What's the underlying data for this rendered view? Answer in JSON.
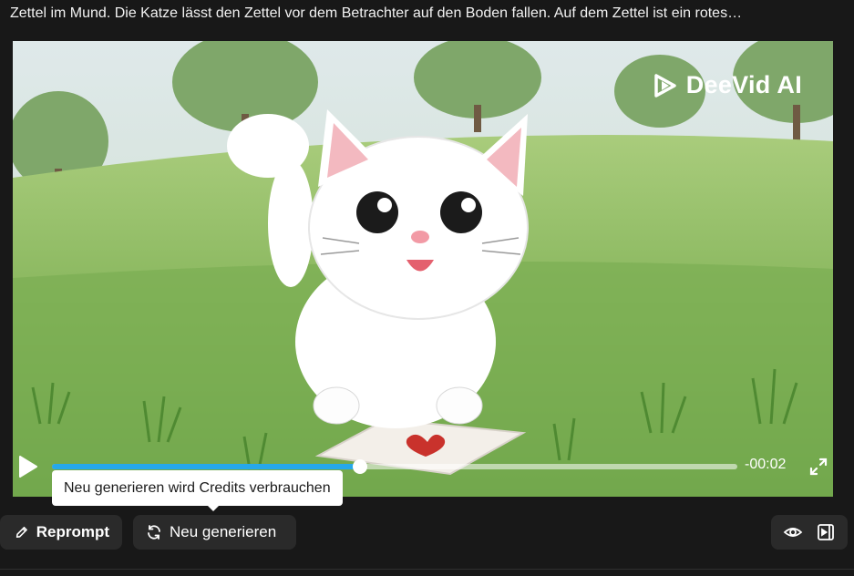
{
  "prompt": {
    "text": "Zettel im Mund. Die Katze lässt den Zettel vor dem Betrachter auf den Boden fallen. Auf dem Zettel ist ein rotes…"
  },
  "video": {
    "watermark": "DeeVid AI",
    "time_remaining": "-00:02",
    "progress": 0.45
  },
  "tooltip": {
    "text": "Neu generieren wird Credits verbrauchen"
  },
  "actions": {
    "reprompt_label": "Reprompt",
    "regenerate_label": "Neu generieren"
  },
  "icons": {
    "play": "play-icon",
    "fullscreen": "fullscreen-icon",
    "reprompt": "pencil-icon",
    "regenerate": "refresh-icon",
    "view": "eye-icon",
    "panel": "panel-play-icon"
  },
  "colors": {
    "accent": "#26a8ea",
    "background": "#181818",
    "button": "#2a2a2a"
  }
}
